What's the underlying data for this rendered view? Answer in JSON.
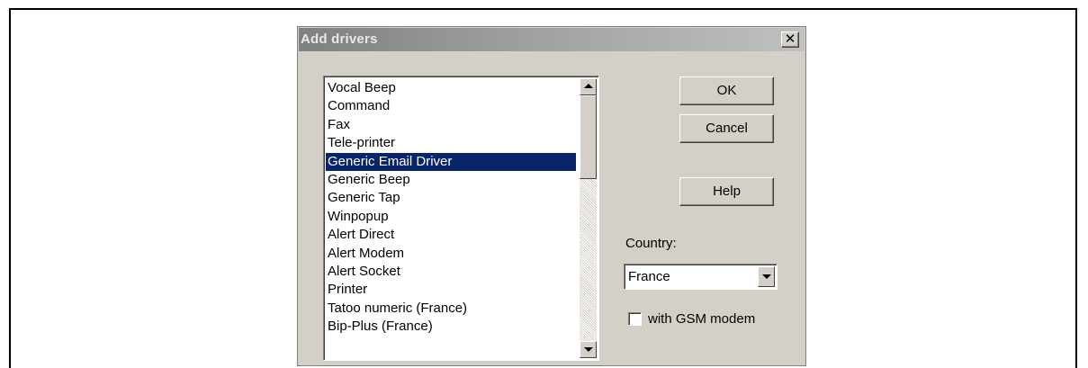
{
  "dialog": {
    "title": "Add drivers",
    "close_glyph": "✕"
  },
  "drivers": {
    "selected_index": 4,
    "items": [
      "Vocal Beep",
      "Command",
      "Fax",
      "Tele-printer",
      "Generic Email Driver",
      "Generic Beep",
      "Generic Tap",
      "Winpopup",
      "Alert Direct",
      "Alert Modem",
      "Alert Socket",
      "Printer",
      "Tatoo numeric (France)",
      "Bip-Plus (France)"
    ]
  },
  "buttons": {
    "ok": "OK",
    "cancel": "Cancel",
    "help": "Help"
  },
  "country": {
    "label": "Country:",
    "value": "France"
  },
  "gsm": {
    "label": "with GSM modem",
    "checked": false
  },
  "icons": {
    "close": "close-icon",
    "scroll_up": "arrow-up-icon",
    "scroll_down": "arrow-down-icon",
    "dropdown": "chevron-down-icon"
  },
  "colors": {
    "selection": "#0a246a",
    "face": "#d4d0c8"
  }
}
